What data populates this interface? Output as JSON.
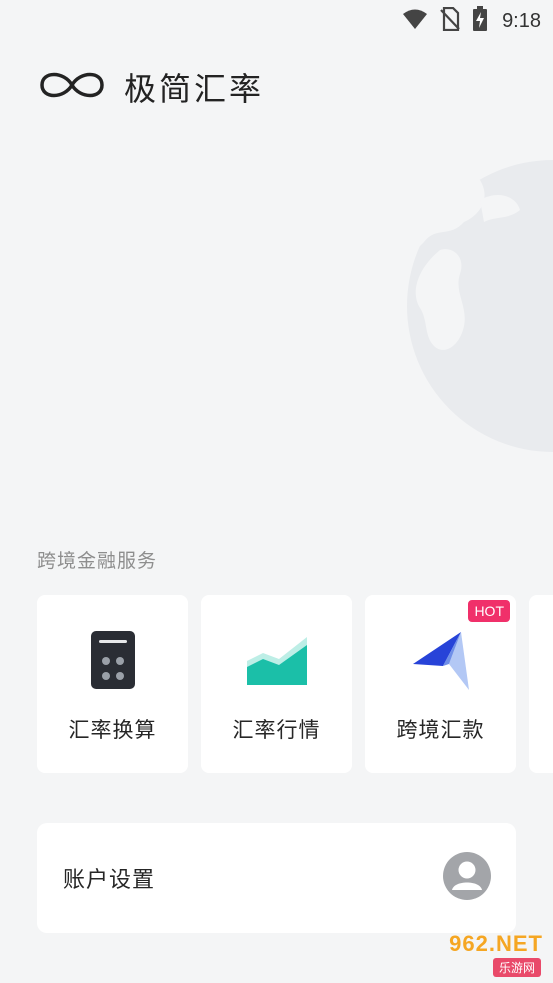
{
  "status_bar": {
    "time": "9:18",
    "icons": [
      "wifi-icon",
      "no-sim-icon",
      "battery-charging-icon"
    ]
  },
  "header": {
    "logo_icon": "infinity-icon",
    "title": "极简汇率"
  },
  "services": {
    "section_title": "跨境金融服务",
    "items": [
      {
        "label": "汇率换算",
        "icon": "calculator-icon",
        "icon_color": "#2a2d34"
      },
      {
        "label": "汇率行情",
        "icon": "trend-chart-icon",
        "icon_color": "#1bbfa8"
      },
      {
        "label": "跨境汇款",
        "icon": "paper-plane-icon",
        "icon_color": "#2743d8",
        "badge": "HOT"
      }
    ]
  },
  "account": {
    "label": "账户设置",
    "icon": "user-avatar-icon"
  },
  "colors": {
    "background": "#f4f5f6",
    "card": "#ffffff",
    "hot_badge": "#f0306a",
    "section_text": "#8e8e8e"
  },
  "watermark": {
    "top": "962.NET",
    "bottom": "乐游网"
  }
}
